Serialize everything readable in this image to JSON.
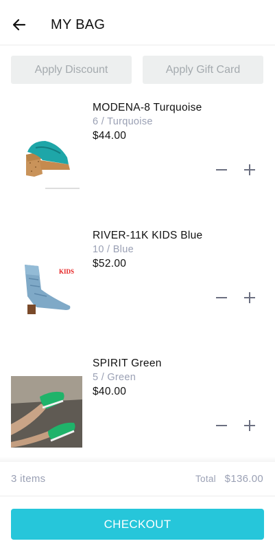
{
  "header": {
    "title": "MY BAG",
    "back_icon": "arrow-left-icon"
  },
  "actions": {
    "discount_label": "Apply Discount",
    "gift_card_label": "Apply Gift Card"
  },
  "items": [
    {
      "name": "MODENA-8 Turquoise",
      "variant": "6 / Turquoise",
      "price": "$44.00",
      "image": "turquoise-platform-sandal"
    },
    {
      "name": "RIVER-11K KIDS Blue",
      "variant": "10 / Blue",
      "price": "$52.00",
      "image": "blue-glitter-western-boot",
      "image_text": "KIDS"
    },
    {
      "name": "SPIRIT Green",
      "variant": "5 / Green",
      "price": "$40.00",
      "image": "green-sneakers-photo"
    }
  ],
  "summary": {
    "count": "3 items",
    "total_label": "Total",
    "total_value": "$136.00"
  },
  "checkout": {
    "label": "CHECKOUT"
  },
  "colors": {
    "accent": "#26c6da",
    "muted_text": "#9aa0b4",
    "grey_button": "#edefef"
  }
}
